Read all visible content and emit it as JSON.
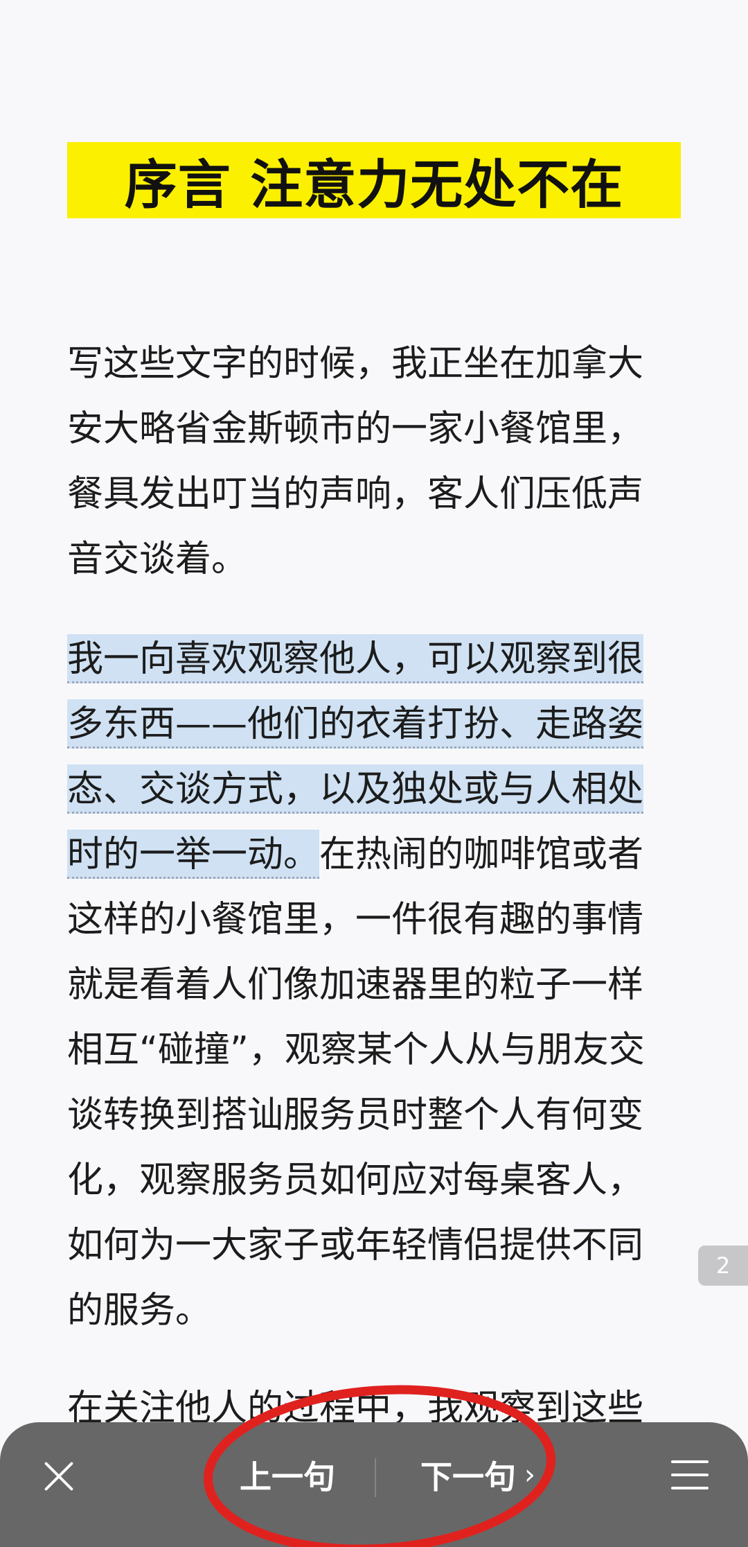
{
  "document": {
    "title": "序言 注意力无处不在",
    "paragraphs": [
      {
        "lines": [
          "写这些文字的时候，我正坐在加拿大",
          "安大略省金斯顿市的一家小餐馆里，",
          "餐具发出叮当的声响，客人们压低声",
          "音交谈着。"
        ]
      },
      {
        "highlighted_lines": [
          "我一向喜欢观察他人，可以观察到很",
          "多东西——他们的衣着打扮、走路姿",
          "态、交谈方式，以及独处或与人相处",
          "时的一举一动。"
        ],
        "rest_of_line": "在热闹的咖啡馆或者",
        "lines": [
          "这样的小餐馆里，一件很有趣的事情",
          "就是看着人们像加速器里的粒子一样",
          "相互“碰撞”，观察某个人从与朋友交",
          "谈转换到搭讪服务员时整个人有何变",
          "化，观察服务员如何应对每桌客人，",
          "如何为一大家子或年轻情侣提供不同",
          "的服务。"
        ]
      },
      {
        "lines": [
          "在关注他人的过程中，我观察到这些"
        ]
      }
    ]
  },
  "page_indicator": "2",
  "toolbar": {
    "close_icon": "close-icon",
    "prev_label": "上一句",
    "next_label": "下一句",
    "next_chevron": "›",
    "menu_icon": "menu-icon"
  },
  "colors": {
    "title_highlight": "#fbf000",
    "sentence_highlight": "#cfe1f3",
    "toolbar_bg": "#676767",
    "annotation_circle": "#e0221f"
  }
}
